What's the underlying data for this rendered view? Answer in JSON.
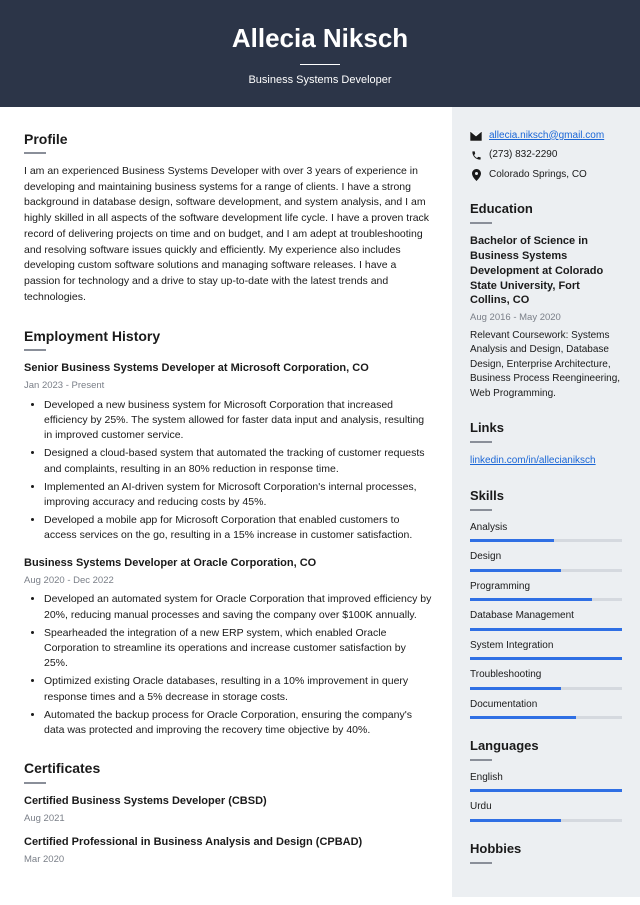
{
  "header": {
    "name": "Allecia Niksch",
    "title": "Business Systems Developer"
  },
  "profile": {
    "heading": "Profile",
    "text": "I am an experienced Business Systems Developer with over 3 years of experience in developing and maintaining business systems for a range of clients. I have a strong background in database design, software development, and system analysis, and I am highly skilled in all aspects of the software development life cycle. I have a proven track record of delivering projects on time and on budget, and I am adept at troubleshooting and resolving software issues quickly and efficiently. My experience also includes developing custom software solutions and managing software releases. I have a passion for technology and a drive to stay up-to-date with the latest trends and technologies."
  },
  "employment": {
    "heading": "Employment History",
    "jobs": [
      {
        "title": "Senior Business Systems Developer at Microsoft Corporation, CO",
        "dates": "Jan 2023 - Present",
        "bullets": [
          "Developed a new business system for Microsoft Corporation that increased efficiency by 25%. The system allowed for faster data input and analysis, resulting in improved customer service.",
          "Designed a cloud-based system that automated the tracking of customer requests and complaints, resulting in an 80% reduction in response time.",
          "Implemented an AI-driven system for Microsoft Corporation's internal processes, improving accuracy and reducing costs by 45%.",
          "Developed a mobile app for Microsoft Corporation that enabled customers to access services on the go, resulting in a 15% increase in customer satisfaction."
        ]
      },
      {
        "title": "Business Systems Developer at Oracle Corporation, CO",
        "dates": "Aug 2020 - Dec 2022",
        "bullets": [
          "Developed an automated system for Oracle Corporation that improved efficiency by 20%, reducing manual processes and saving the company over $100K annually.",
          "Spearheaded the integration of a new ERP system, which enabled Oracle Corporation to streamline its operations and increase customer satisfaction by 25%.",
          "Optimized existing Oracle databases, resulting in a 10% improvement in query response times and a 5% decrease in storage costs.",
          "Automated the backup process for Oracle Corporation, ensuring the company's data was protected and improving the recovery time objective by 40%."
        ]
      }
    ]
  },
  "certificates": {
    "heading": "Certificates",
    "items": [
      {
        "title": "Certified Business Systems Developer (CBSD)",
        "date": "Aug 2021"
      },
      {
        "title": "Certified Professional in Business Analysis and Design (CPBAD)",
        "date": "Mar 2020"
      }
    ]
  },
  "contact": {
    "email": "allecia.niksch@gmail.com",
    "phone": "(273) 832-2290",
    "location": "Colorado Springs, CO"
  },
  "education": {
    "heading": "Education",
    "degree": "Bachelor of Science in Business Systems Development at Colorado State University, Fort Collins, CO",
    "dates": "Aug 2016 - May 2020",
    "text": "Relevant Coursework: Systems Analysis and Design, Database Design, Enterprise Architecture, Business Process Reengineering, Web Programming."
  },
  "links": {
    "heading": "Links",
    "items": [
      "linkedin.com/in/allecianiksch"
    ]
  },
  "skills": {
    "heading": "Skills",
    "items": [
      {
        "name": "Analysis",
        "level": 55
      },
      {
        "name": "Design",
        "level": 60
      },
      {
        "name": "Programming",
        "level": 80
      },
      {
        "name": "Database Management",
        "level": 100
      },
      {
        "name": "System Integration",
        "level": 100
      },
      {
        "name": "Troubleshooting",
        "level": 60
      },
      {
        "name": "Documentation",
        "level": 70
      }
    ]
  },
  "languages": {
    "heading": "Languages",
    "items": [
      {
        "name": "English",
        "level": 100
      },
      {
        "name": "Urdu",
        "level": 60
      }
    ]
  },
  "hobbies": {
    "heading": "Hobbies"
  }
}
